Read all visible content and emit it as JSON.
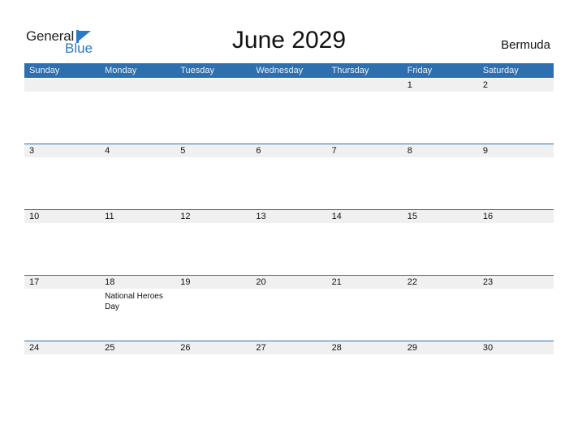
{
  "logo": {
    "line1": "General",
    "line2": "Blue"
  },
  "title": "June 2029",
  "country": "Bermuda",
  "colors": {
    "accent": "#2e6fb0",
    "brand_blue": "#2a79c2",
    "date_strip": "#f0f0f0"
  },
  "weekdays": [
    "Sunday",
    "Monday",
    "Tuesday",
    "Wednesday",
    "Thursday",
    "Friday",
    "Saturday"
  ],
  "weeks": [
    {
      "days": [
        "",
        "",
        "",
        "",
        "",
        "1",
        "2"
      ]
    },
    {
      "days": [
        "3",
        "4",
        "5",
        "6",
        "7",
        "8",
        "9"
      ]
    },
    {
      "days": [
        "10",
        "11",
        "12",
        "13",
        "14",
        "15",
        "16"
      ]
    },
    {
      "days": [
        "17",
        "18",
        "19",
        "20",
        "21",
        "22",
        "23"
      ]
    },
    {
      "days": [
        "24",
        "25",
        "26",
        "27",
        "28",
        "29",
        "30"
      ]
    }
  ],
  "events": [
    {
      "week": 3,
      "day": 1,
      "date": "18",
      "label": "National Heroes Day"
    }
  ]
}
